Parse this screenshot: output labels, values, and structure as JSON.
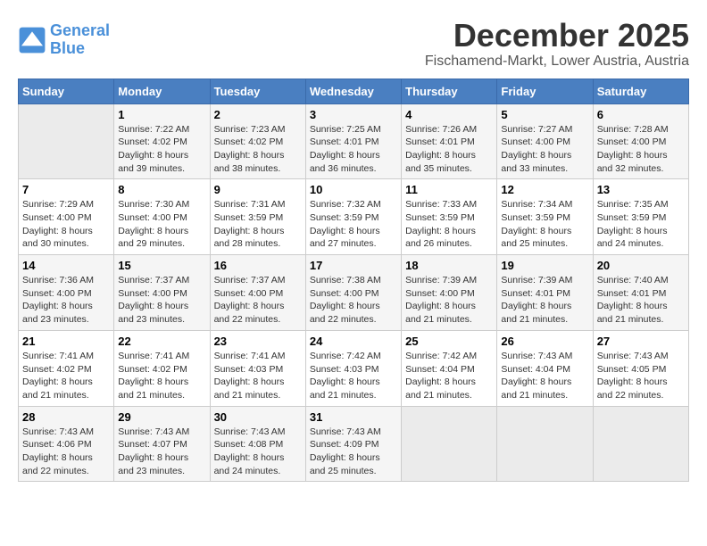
{
  "header": {
    "logo_line1": "General",
    "logo_line2": "Blue",
    "month": "December 2025",
    "location": "Fischamend-Markt, Lower Austria, Austria"
  },
  "weekdays": [
    "Sunday",
    "Monday",
    "Tuesday",
    "Wednesday",
    "Thursday",
    "Friday",
    "Saturday"
  ],
  "weeks": [
    [
      {
        "day": "",
        "info": ""
      },
      {
        "day": "1",
        "info": "Sunrise: 7:22 AM\nSunset: 4:02 PM\nDaylight: 8 hours\nand 39 minutes."
      },
      {
        "day": "2",
        "info": "Sunrise: 7:23 AM\nSunset: 4:02 PM\nDaylight: 8 hours\nand 38 minutes."
      },
      {
        "day": "3",
        "info": "Sunrise: 7:25 AM\nSunset: 4:01 PM\nDaylight: 8 hours\nand 36 minutes."
      },
      {
        "day": "4",
        "info": "Sunrise: 7:26 AM\nSunset: 4:01 PM\nDaylight: 8 hours\nand 35 minutes."
      },
      {
        "day": "5",
        "info": "Sunrise: 7:27 AM\nSunset: 4:00 PM\nDaylight: 8 hours\nand 33 minutes."
      },
      {
        "day": "6",
        "info": "Sunrise: 7:28 AM\nSunset: 4:00 PM\nDaylight: 8 hours\nand 32 minutes."
      }
    ],
    [
      {
        "day": "7",
        "info": "Sunrise: 7:29 AM\nSunset: 4:00 PM\nDaylight: 8 hours\nand 30 minutes."
      },
      {
        "day": "8",
        "info": "Sunrise: 7:30 AM\nSunset: 4:00 PM\nDaylight: 8 hours\nand 29 minutes."
      },
      {
        "day": "9",
        "info": "Sunrise: 7:31 AM\nSunset: 3:59 PM\nDaylight: 8 hours\nand 28 minutes."
      },
      {
        "day": "10",
        "info": "Sunrise: 7:32 AM\nSunset: 3:59 PM\nDaylight: 8 hours\nand 27 minutes."
      },
      {
        "day": "11",
        "info": "Sunrise: 7:33 AM\nSunset: 3:59 PM\nDaylight: 8 hours\nand 26 minutes."
      },
      {
        "day": "12",
        "info": "Sunrise: 7:34 AM\nSunset: 3:59 PM\nDaylight: 8 hours\nand 25 minutes."
      },
      {
        "day": "13",
        "info": "Sunrise: 7:35 AM\nSunset: 3:59 PM\nDaylight: 8 hours\nand 24 minutes."
      }
    ],
    [
      {
        "day": "14",
        "info": "Sunrise: 7:36 AM\nSunset: 4:00 PM\nDaylight: 8 hours\nand 23 minutes."
      },
      {
        "day": "15",
        "info": "Sunrise: 7:37 AM\nSunset: 4:00 PM\nDaylight: 8 hours\nand 23 minutes."
      },
      {
        "day": "16",
        "info": "Sunrise: 7:37 AM\nSunset: 4:00 PM\nDaylight: 8 hours\nand 22 minutes."
      },
      {
        "day": "17",
        "info": "Sunrise: 7:38 AM\nSunset: 4:00 PM\nDaylight: 8 hours\nand 22 minutes."
      },
      {
        "day": "18",
        "info": "Sunrise: 7:39 AM\nSunset: 4:00 PM\nDaylight: 8 hours\nand 21 minutes."
      },
      {
        "day": "19",
        "info": "Sunrise: 7:39 AM\nSunset: 4:01 PM\nDaylight: 8 hours\nand 21 minutes."
      },
      {
        "day": "20",
        "info": "Sunrise: 7:40 AM\nSunset: 4:01 PM\nDaylight: 8 hours\nand 21 minutes."
      }
    ],
    [
      {
        "day": "21",
        "info": "Sunrise: 7:41 AM\nSunset: 4:02 PM\nDaylight: 8 hours\nand 21 minutes."
      },
      {
        "day": "22",
        "info": "Sunrise: 7:41 AM\nSunset: 4:02 PM\nDaylight: 8 hours\nand 21 minutes."
      },
      {
        "day": "23",
        "info": "Sunrise: 7:41 AM\nSunset: 4:03 PM\nDaylight: 8 hours\nand 21 minutes."
      },
      {
        "day": "24",
        "info": "Sunrise: 7:42 AM\nSunset: 4:03 PM\nDaylight: 8 hours\nand 21 minutes."
      },
      {
        "day": "25",
        "info": "Sunrise: 7:42 AM\nSunset: 4:04 PM\nDaylight: 8 hours\nand 21 minutes."
      },
      {
        "day": "26",
        "info": "Sunrise: 7:43 AM\nSunset: 4:04 PM\nDaylight: 8 hours\nand 21 minutes."
      },
      {
        "day": "27",
        "info": "Sunrise: 7:43 AM\nSunset: 4:05 PM\nDaylight: 8 hours\nand 22 minutes."
      }
    ],
    [
      {
        "day": "28",
        "info": "Sunrise: 7:43 AM\nSunset: 4:06 PM\nDaylight: 8 hours\nand 22 minutes."
      },
      {
        "day": "29",
        "info": "Sunrise: 7:43 AM\nSunset: 4:07 PM\nDaylight: 8 hours\nand 23 minutes."
      },
      {
        "day": "30",
        "info": "Sunrise: 7:43 AM\nSunset: 4:08 PM\nDaylight: 8 hours\nand 24 minutes."
      },
      {
        "day": "31",
        "info": "Sunrise: 7:43 AM\nSunset: 4:09 PM\nDaylight: 8 hours\nand 25 minutes."
      },
      {
        "day": "",
        "info": ""
      },
      {
        "day": "",
        "info": ""
      },
      {
        "day": "",
        "info": ""
      }
    ]
  ]
}
